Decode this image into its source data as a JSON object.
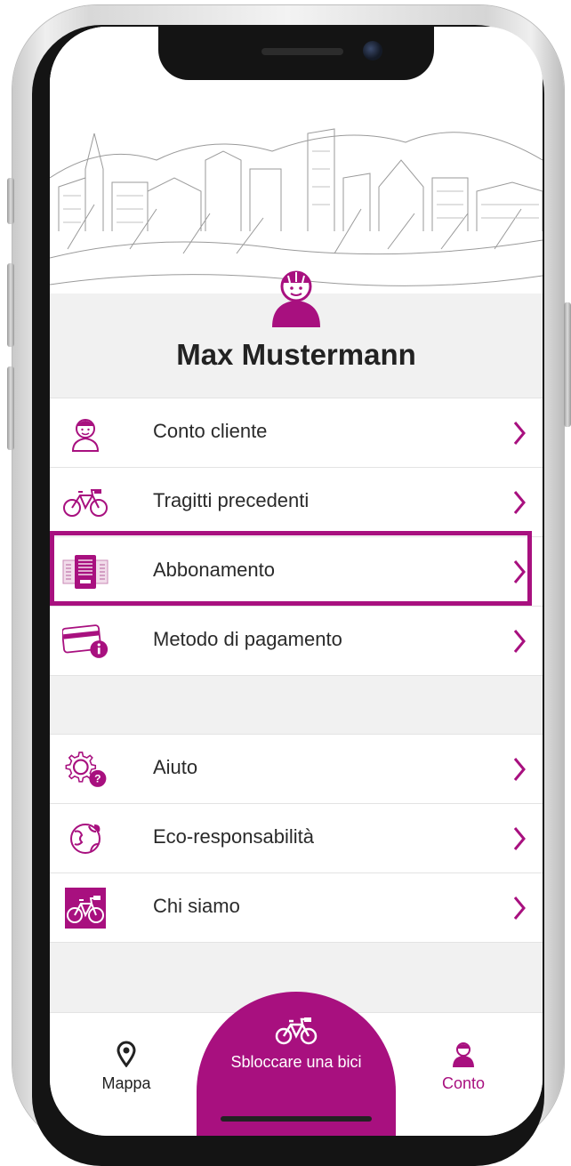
{
  "theme": {
    "accent": "#a8107f",
    "text": "#2a2a2a"
  },
  "profile": {
    "name": "Max Mustermann",
    "avatar_icon": "cyclist-avatar-icon"
  },
  "menu_primary": [
    {
      "label": "Conto cliente",
      "icon": "user-icon"
    },
    {
      "label": "Tragitti precedenti",
      "icon": "bike-icon"
    },
    {
      "label": "Abbonamento",
      "icon": "ticket-icon"
    },
    {
      "label": "Metodo di pagamento",
      "icon": "credit-card-icon"
    }
  ],
  "menu_secondary": [
    {
      "label": "Aiuto",
      "icon": "help-gear-icon"
    },
    {
      "label": "Eco-responsabilità",
      "icon": "globe-icon"
    },
    {
      "label": "Chi siamo",
      "icon": "bike-square-icon"
    }
  ],
  "tabbar": {
    "map": "Mappa",
    "unlock": "Sbloccare una bici",
    "account": "Conto"
  }
}
